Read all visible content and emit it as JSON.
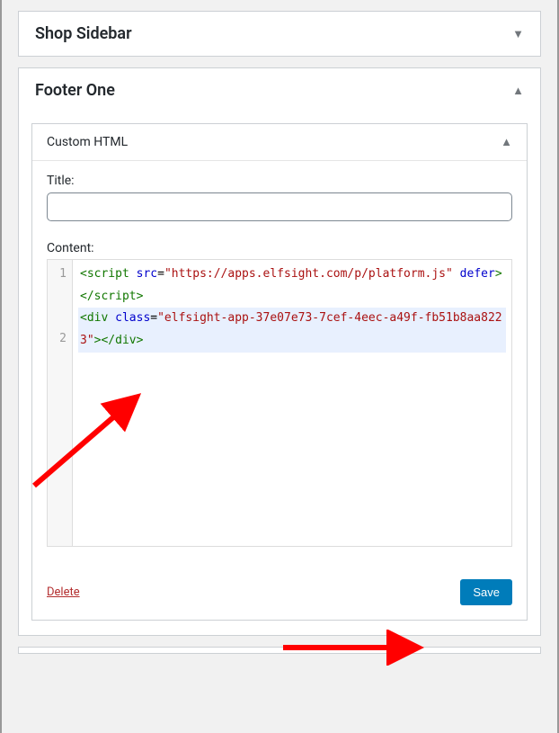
{
  "areas": {
    "shop_sidebar": {
      "title": "Shop Sidebar"
    },
    "footer_one": {
      "title": "Footer One"
    }
  },
  "widget": {
    "name": "Custom HTML",
    "title_label": "Title:",
    "title_value": "",
    "content_label": "Content:",
    "line_numbers": [
      "1",
      "2"
    ],
    "code_lines": [
      {
        "active": false,
        "tokens": [
          {
            "cls": "tag",
            "t": "<script"
          },
          {
            "cls": "",
            "t": " "
          },
          {
            "cls": "attr",
            "t": "src"
          },
          {
            "cls": "",
            "t": "="
          },
          {
            "cls": "str",
            "t": "\"https://apps.elfsight.com/p/platform.js\""
          },
          {
            "cls": "",
            "t": " "
          },
          {
            "cls": "attr",
            "t": "defer"
          },
          {
            "cls": "tag",
            "t": ">"
          },
          {
            "cls": "tag",
            "t": "</‎script>"
          }
        ]
      },
      {
        "active": true,
        "tokens": [
          {
            "cls": "tag",
            "t": "<div"
          },
          {
            "cls": "",
            "t": " "
          },
          {
            "cls": "attr",
            "t": "class"
          },
          {
            "cls": "",
            "t": "="
          },
          {
            "cls": "str",
            "t": "\"elfsight-app-37e07e73-7cef-4eec-a49f-fb51b8aa8223\""
          },
          {
            "cls": "tag",
            "t": ">"
          },
          {
            "cls": "tag",
            "t": "</div>"
          }
        ]
      }
    ]
  },
  "actions": {
    "delete": "Delete",
    "save": "Save"
  }
}
